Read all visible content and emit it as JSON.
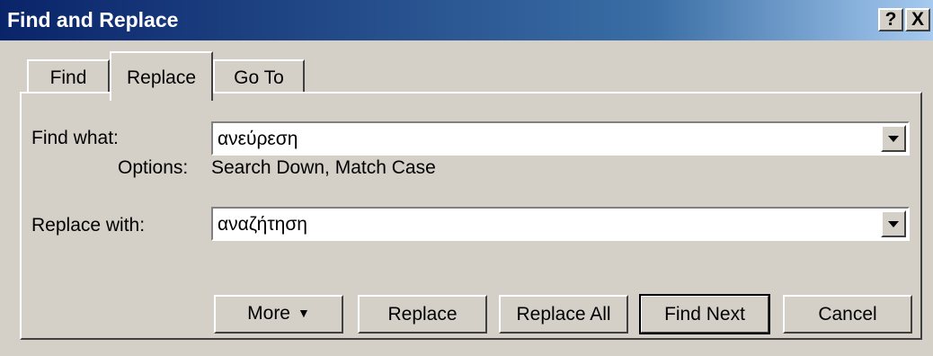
{
  "window": {
    "title": "Find and Replace",
    "help_label": "?",
    "close_label": "X"
  },
  "tabs": [
    {
      "label": "Find",
      "active": false
    },
    {
      "label": "Replace",
      "active": true
    },
    {
      "label": "Go To",
      "active": false
    }
  ],
  "find": {
    "label": "Find what:",
    "value": "ανεύρεση",
    "options_label": "Options:",
    "options_value": "Search Down, Match Case"
  },
  "replace": {
    "label": "Replace with:",
    "value": "αναζήτηση"
  },
  "buttons": {
    "more": "More",
    "more_arrow": "▼",
    "replace": "Replace",
    "replace_all": "Replace All",
    "find_next": "Find Next",
    "cancel": "Cancel"
  },
  "colors": {
    "titlebar_start": "#0a246a",
    "titlebar_end": "#a6caf0",
    "face": "#d4d0c8"
  }
}
